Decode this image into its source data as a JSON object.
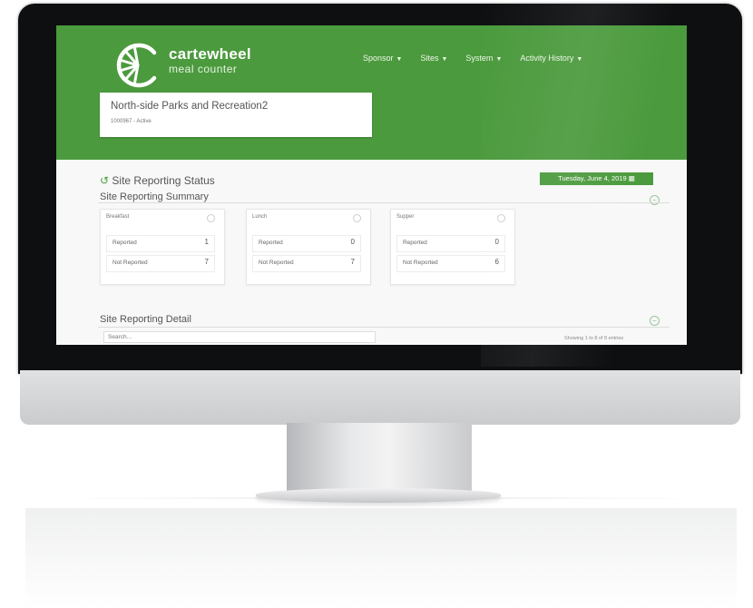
{
  "brand": {
    "name": "cartewheel",
    "subtitle": "meal counter"
  },
  "nav": [
    {
      "label": "Sponsor"
    },
    {
      "label": "Sites"
    },
    {
      "label": "System"
    },
    {
      "label": "Activity History"
    }
  ],
  "organization": {
    "name": "North-side Parks and Recreation2",
    "subtitle": "1000967 - Active"
  },
  "status": {
    "title": "Site Reporting Status",
    "date": "Tuesday, June 4, 2019"
  },
  "summary": {
    "title": "Site Reporting Summary",
    "cards": [
      {
        "title": "Breakfast",
        "reported_label": "Reported",
        "reported_value": "1",
        "not_reported_label": "Not Reported",
        "not_reported_value": "7"
      },
      {
        "title": "Lunch",
        "reported_label": "Reported",
        "reported_value": "0",
        "not_reported_label": "Not Reported",
        "not_reported_value": "7"
      },
      {
        "title": "Supper",
        "reported_label": "Reported",
        "reported_value": "0",
        "not_reported_label": "Not Reported",
        "not_reported_value": "6"
      }
    ]
  },
  "detail": {
    "title": "Site Reporting Detail",
    "search_placeholder": "Search...",
    "entries": "Showing 1 to 8 of 8 entries"
  },
  "colors": {
    "brand_green": "#4b9a3d",
    "monitor_bezel": "#0e0f11",
    "monitor_chin": "#d6d8da"
  },
  "icons": {
    "logo": "wheel-logo-icon",
    "calendar": "calendar-icon",
    "caret": "caret-down-icon",
    "collapse": "collapse-icon"
  }
}
